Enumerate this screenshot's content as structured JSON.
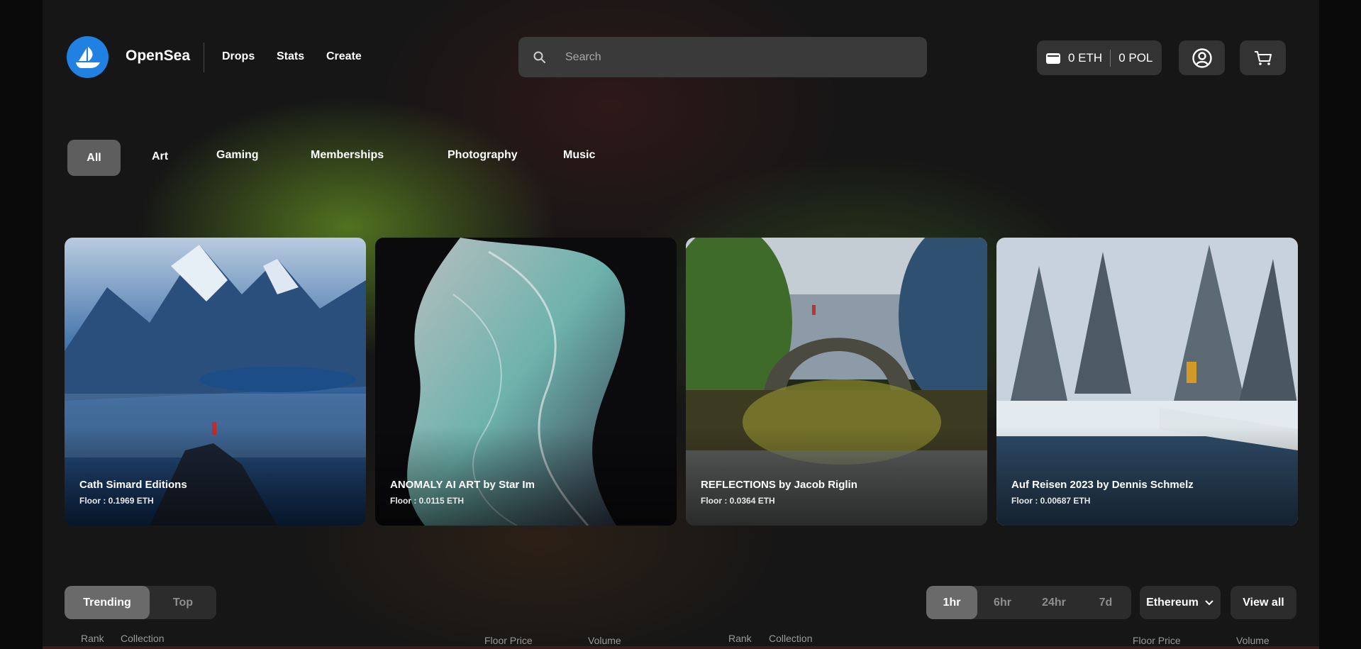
{
  "header": {
    "brand": "OpenSea",
    "nav": [
      "Drops",
      "Stats",
      "Create"
    ],
    "search_placeholder": "Search",
    "wallet_eth": "0 ETH",
    "wallet_pol": "0 POL"
  },
  "categories": [
    "All",
    "Art",
    "Gaming",
    "Memberships",
    "Photography",
    "Music"
  ],
  "active_category": "All",
  "featured": [
    {
      "title": "Cath Simard Editions",
      "floor": "Floor : 0.1969 ETH"
    },
    {
      "title": "ANOMALY AI ART by Star Im",
      "floor": "Floor : 0.0115 ETH"
    },
    {
      "title": "REFLECTIONS by Jacob Riglin",
      "floor": "Floor : 0.0364 ETH"
    },
    {
      "title": "Auf Reisen 2023 by Dennis Schmelz",
      "floor": "Floor : 0.00687 ETH"
    }
  ],
  "ranking": {
    "tabs": [
      "Trending",
      "Top"
    ],
    "active_tab": "Trending",
    "time_ranges": [
      "1hr",
      "6hr",
      "24hr",
      "7d"
    ],
    "active_range": "1hr",
    "chain": "Ethereum",
    "view_all": "View all",
    "columns": [
      "Rank",
      "Collection",
      "Floor Price",
      "Volume"
    ]
  },
  "icons": {
    "search": "search-icon",
    "wallet": "wallet-icon",
    "account": "user-circle-icon",
    "cart": "cart-icon",
    "chain_dropdown": "chevron-down-icon"
  },
  "colors": {
    "brand": "#2081e2"
  }
}
